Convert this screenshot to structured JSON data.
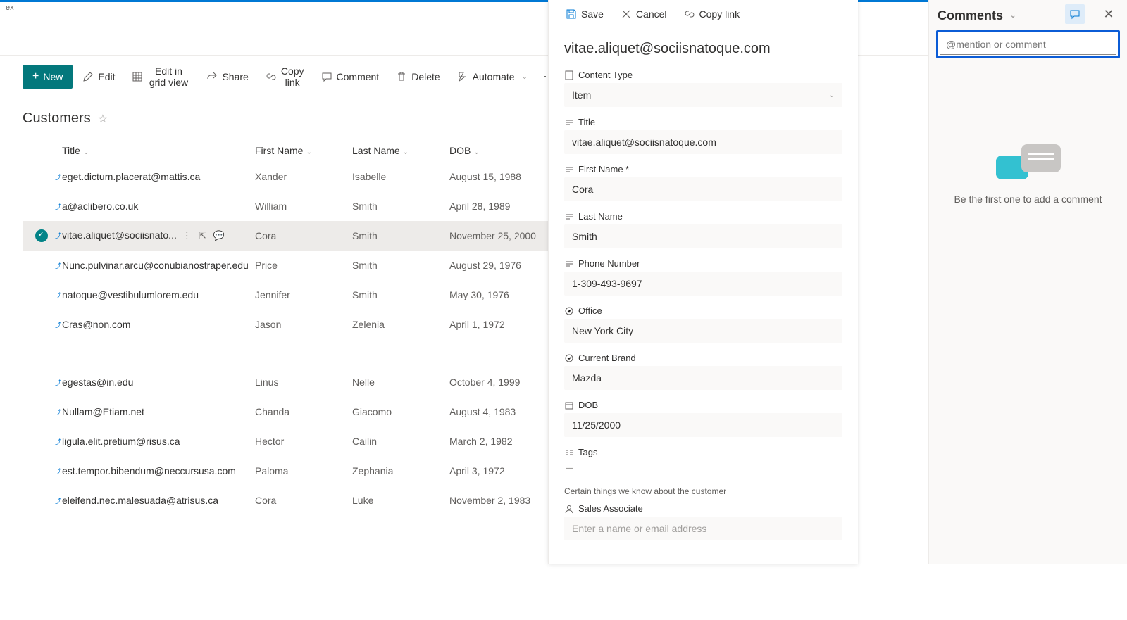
{
  "tab": "ex",
  "commands": {
    "new": "New",
    "edit": "Edit",
    "grid": "Edit in grid view",
    "share": "Share",
    "copylink": "Copy link",
    "comment": "Comment",
    "delete": "Delete",
    "automate": "Automate"
  },
  "list": {
    "title": "Customers",
    "columns": {
      "title": "Title",
      "fn": "First Name",
      "ln": "Last Name",
      "dob": "DOB"
    },
    "rows": [
      {
        "title": "eget.dictum.placerat@mattis.ca",
        "fn": "Xander",
        "ln": "Isabelle",
        "dob": "August 15, 1988"
      },
      {
        "title": "a@aclibero.co.uk",
        "fn": "William",
        "ln": "Smith",
        "dob": "April 28, 1989"
      },
      {
        "title": "vitae.aliquet@sociisnato...",
        "fn": "Cora",
        "ln": "Smith",
        "dob": "November 25, 2000",
        "selected": true
      },
      {
        "title": "Nunc.pulvinar.arcu@conubianostraper.edu",
        "fn": "Price",
        "ln": "Smith",
        "dob": "August 29, 1976"
      },
      {
        "title": "natoque@vestibulumlorem.edu",
        "fn": "Jennifer",
        "ln": "Smith",
        "dob": "May 30, 1976"
      },
      {
        "title": "Cras@non.com",
        "fn": "Jason",
        "ln": "Zelenia",
        "dob": "April 1, 1972"
      },
      {
        "title": "egestas@in.edu",
        "fn": "Linus",
        "ln": "Nelle",
        "dob": "October 4, 1999",
        "gap": true
      },
      {
        "title": "Nullam@Etiam.net",
        "fn": "Chanda",
        "ln": "Giacomo",
        "dob": "August 4, 1983"
      },
      {
        "title": "ligula.elit.pretium@risus.ca",
        "fn": "Hector",
        "ln": "Cailin",
        "dob": "March 2, 1982"
      },
      {
        "title": "est.tempor.bibendum@neccursusa.com",
        "fn": "Paloma",
        "ln": "Zephania",
        "dob": "April 3, 1972"
      },
      {
        "title": "eleifend.nec.malesuada@atrisus.ca",
        "fn": "Cora",
        "ln": "Luke",
        "dob": "November 2, 1983"
      }
    ]
  },
  "panel": {
    "save": "Save",
    "cancel": "Cancel",
    "copylink": "Copy link",
    "heading": "vitae.aliquet@sociisnatoque.com",
    "fields": {
      "contentType": {
        "label": "Content Type",
        "value": "Item"
      },
      "title": {
        "label": "Title",
        "value": "vitae.aliquet@sociisnatoque.com"
      },
      "firstName": {
        "label": "First Name *",
        "value": "Cora"
      },
      "lastName": {
        "label": "Last Name",
        "value": "Smith"
      },
      "phone": {
        "label": "Phone Number",
        "value": "1-309-493-9697"
      },
      "office": {
        "label": "Office",
        "value": "New York City"
      },
      "brand": {
        "label": "Current Brand",
        "value": "Mazda"
      },
      "dob": {
        "label": "DOB",
        "value": "11/25/2000"
      },
      "tags": {
        "label": "Tags",
        "value": "--"
      },
      "note": "Certain things we know about the customer",
      "sales": {
        "label": "Sales Associate",
        "placeholder": "Enter a name or email address"
      }
    }
  },
  "comments": {
    "title": "Comments",
    "placeholder": "@mention or comment",
    "empty": "Be the first one to add a comment"
  }
}
